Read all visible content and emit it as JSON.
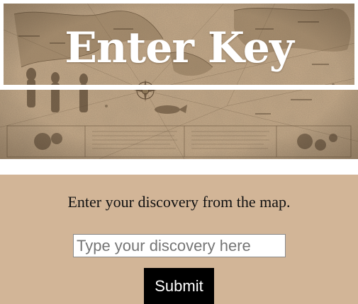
{
  "header": {
    "title": "Enter Key",
    "banner_image": "antique-world-map"
  },
  "form": {
    "prompt": "Enter your discovery from the map.",
    "input_placeholder": "Type your discovery here",
    "input_value": "",
    "submit_label": "Submit"
  },
  "colors": {
    "panel_background": "#d2b597",
    "map_parchment": "#c9ad8c",
    "button_background": "#000000",
    "button_text": "#ffffff",
    "title_text": "#ffffff"
  }
}
